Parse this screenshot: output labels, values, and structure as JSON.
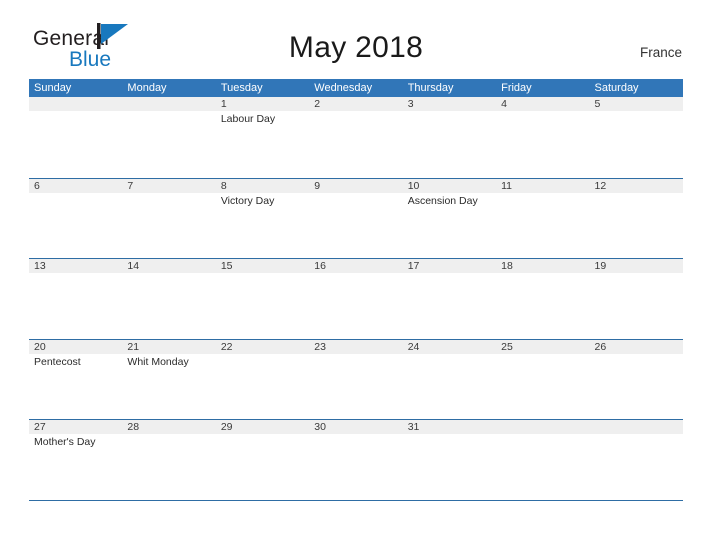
{
  "brand": {
    "name_part1": "General",
    "name_part2": "Blue",
    "flag_icon": "flag-triangle-icon",
    "accent_color": "#1878be"
  },
  "header": {
    "title": "May 2018",
    "country": "France"
  },
  "colors": {
    "header_blue": "#3176b8",
    "rule_blue": "#2e6da4",
    "date_band_gray": "#efefef",
    "text": "#2b2b2b"
  },
  "calendar": {
    "weekdays": [
      "Sunday",
      "Monday",
      "Tuesday",
      "Wednesday",
      "Thursday",
      "Friday",
      "Saturday"
    ],
    "weeks": [
      {
        "days": [
          {
            "date": "",
            "event": ""
          },
          {
            "date": "",
            "event": ""
          },
          {
            "date": "1",
            "event": "Labour Day"
          },
          {
            "date": "2",
            "event": ""
          },
          {
            "date": "3",
            "event": ""
          },
          {
            "date": "4",
            "event": ""
          },
          {
            "date": "5",
            "event": ""
          }
        ]
      },
      {
        "days": [
          {
            "date": "6",
            "event": ""
          },
          {
            "date": "7",
            "event": ""
          },
          {
            "date": "8",
            "event": "Victory Day"
          },
          {
            "date": "9",
            "event": ""
          },
          {
            "date": "10",
            "event": "Ascension Day"
          },
          {
            "date": "11",
            "event": ""
          },
          {
            "date": "12",
            "event": ""
          }
        ]
      },
      {
        "days": [
          {
            "date": "13",
            "event": ""
          },
          {
            "date": "14",
            "event": ""
          },
          {
            "date": "15",
            "event": ""
          },
          {
            "date": "16",
            "event": ""
          },
          {
            "date": "17",
            "event": ""
          },
          {
            "date": "18",
            "event": ""
          },
          {
            "date": "19",
            "event": ""
          }
        ]
      },
      {
        "days": [
          {
            "date": "20",
            "event": "Pentecost"
          },
          {
            "date": "21",
            "event": "Whit Monday"
          },
          {
            "date": "22",
            "event": ""
          },
          {
            "date": "23",
            "event": ""
          },
          {
            "date": "24",
            "event": ""
          },
          {
            "date": "25",
            "event": ""
          },
          {
            "date": "26",
            "event": ""
          }
        ]
      },
      {
        "days": [
          {
            "date": "27",
            "event": "Mother's Day"
          },
          {
            "date": "28",
            "event": ""
          },
          {
            "date": "29",
            "event": ""
          },
          {
            "date": "30",
            "event": ""
          },
          {
            "date": "31",
            "event": ""
          },
          {
            "date": "",
            "event": ""
          },
          {
            "date": "",
            "event": ""
          }
        ]
      }
    ]
  }
}
